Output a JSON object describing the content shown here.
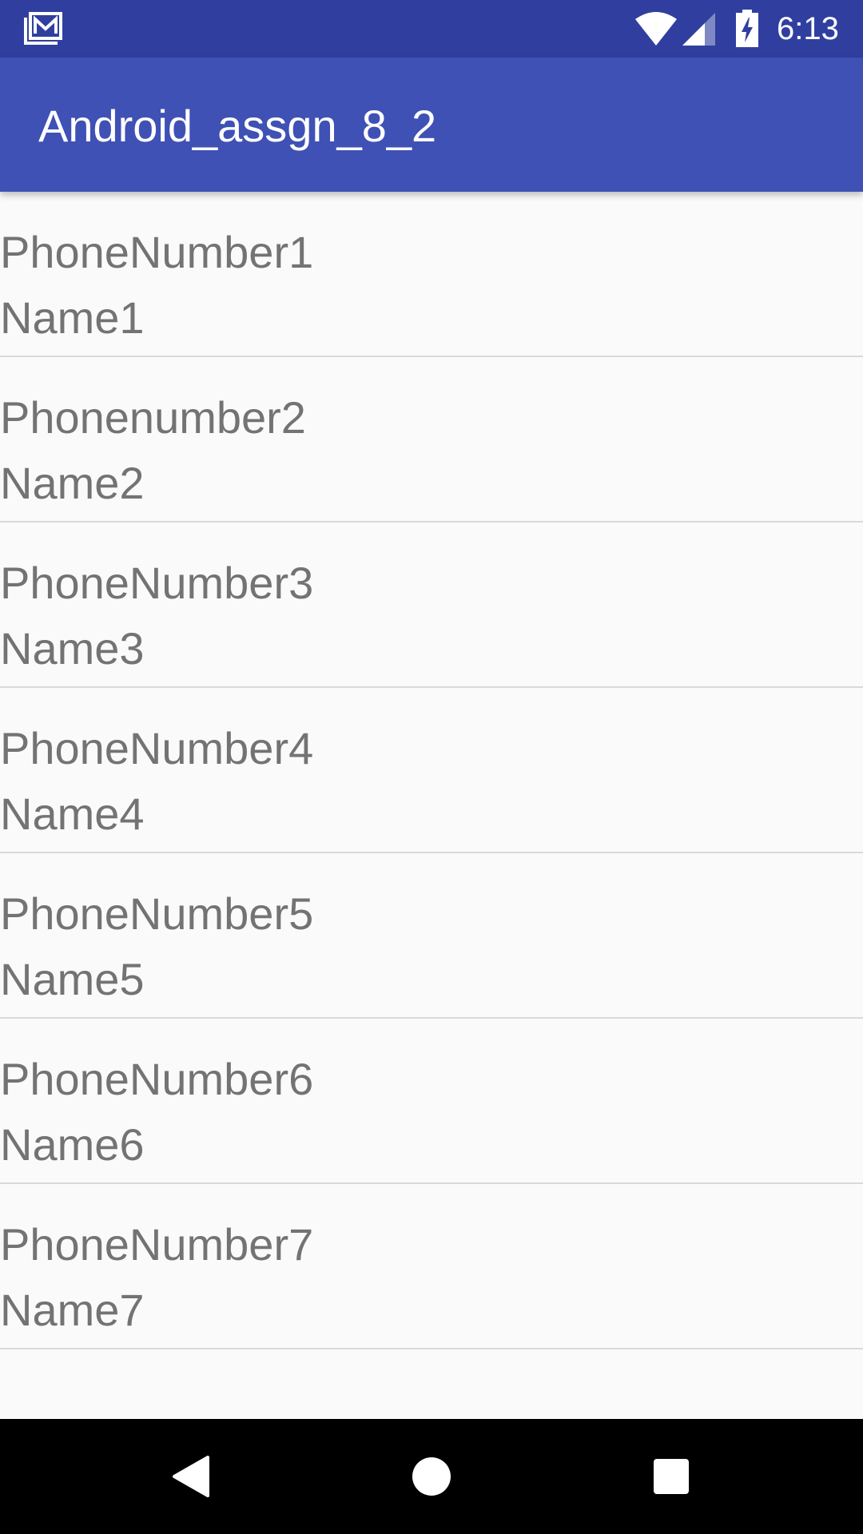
{
  "status_bar": {
    "time": "6:13",
    "icons": [
      "gmail-icon",
      "wifi-icon",
      "cellular-signal-icon",
      "battery-charging-icon"
    ]
  },
  "app_bar": {
    "title": "Android_assgn_8_2"
  },
  "contacts": [
    {
      "phone": "PhoneNumber1",
      "name": "Name1"
    },
    {
      "phone": "Phonenumber2",
      "name": "Name2"
    },
    {
      "phone": "PhoneNumber3",
      "name": "Name3"
    },
    {
      "phone": "PhoneNumber4",
      "name": "Name4"
    },
    {
      "phone": "PhoneNumber5",
      "name": "Name5"
    },
    {
      "phone": "PhoneNumber6",
      "name": "Name6"
    },
    {
      "phone": "PhoneNumber7",
      "name": "Name7"
    }
  ],
  "nav_bar": {
    "buttons": [
      "back-icon",
      "home-icon",
      "recents-icon"
    ]
  },
  "colors": {
    "status_bar": "#303f9f",
    "primary": "#3f51b5",
    "background": "#fafafa",
    "list_text": "#737373",
    "divider": "#d9d9d9"
  }
}
